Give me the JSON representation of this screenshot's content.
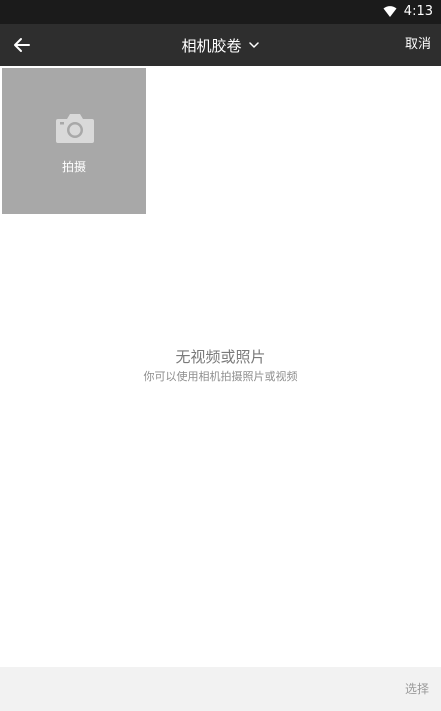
{
  "status_bar": {
    "time": "4:13",
    "wifi_icon": "wifi-icon"
  },
  "app_bar": {
    "back_icon": "arrow-left-icon",
    "title": "相机胶卷",
    "title_icon": "chevron-down-icon",
    "cancel_label": "取消"
  },
  "camera_tile": {
    "icon": "camera-icon",
    "label": "拍摄"
  },
  "empty_state": {
    "title": "无视频或照片",
    "subtitle": "你可以使用相机拍摄照片或视频"
  },
  "bottom_bar": {
    "action_label": "选择"
  },
  "colors": {
    "status_bar_bg": "#1b1b1b",
    "app_bar_bg": "#2e2e2e",
    "tile_bg": "#a8a8a8",
    "empty_text": "#7a7a7a"
  }
}
